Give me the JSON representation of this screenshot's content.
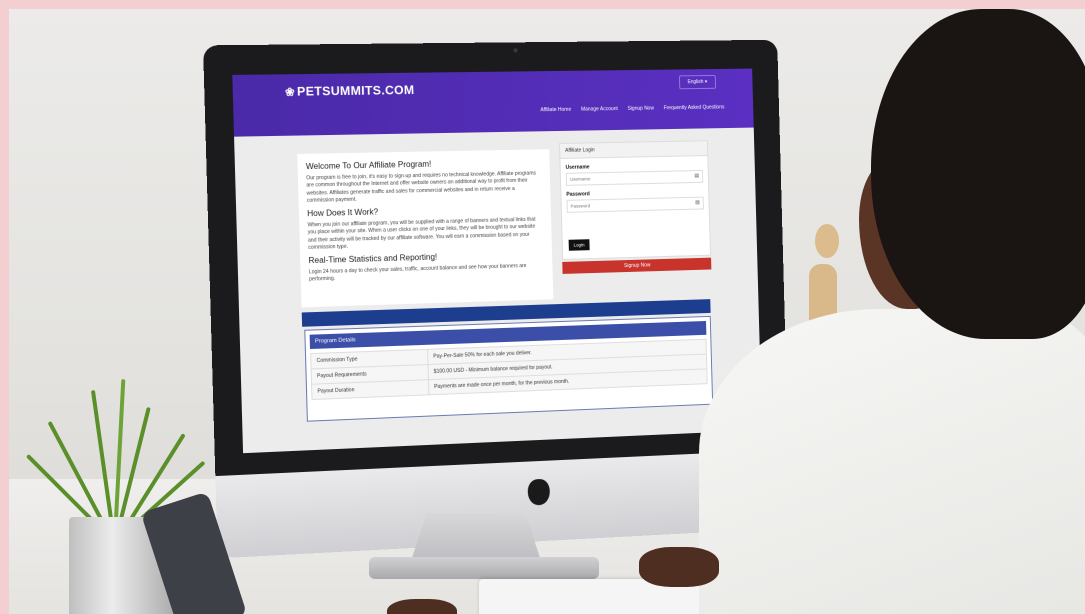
{
  "site": {
    "logo": "PETSUMMITS.COM",
    "language": "English",
    "nav": [
      "Affiliate Home",
      "Manage Account",
      "Signup Now",
      "Frequently Asked Questions"
    ]
  },
  "intro": {
    "h1": "Welcome To Our Affiliate Program!",
    "p1": "Our program is free to join, it's easy to sign-up and requires no technical knowledge. Affiliate programs are common throughout the Internet and offer website owners an additional way to profit from their websites. Affiliates generate traffic and sales for commercial websites and in return receive a commission payment.",
    "h2": "How Does It Work?",
    "p2": "When you join our affiliate program, you will be supplied with a range of banners and textual links that you place within your site. When a user clicks on one of your links, they will be brought to our website and their activity will be tracked by our affiliate software. You will earn a commission based on your commission type.",
    "h3": "Real-Time Statistics and Reporting!",
    "p3": "Login 24 hours a day to check your sales, traffic, account balance and see how your banners are performing."
  },
  "login": {
    "title": "Affiliate Login",
    "username_label": "Username",
    "username_placeholder": "Username",
    "password_label": "Password",
    "password_placeholder": "Password",
    "login_button": "Login",
    "signup_button": "Signup Now"
  },
  "program_details": {
    "title": "Program Details",
    "rows": [
      {
        "label": "Commission Type",
        "value": "Pay-Per-Sale 50% for each sale you deliver."
      },
      {
        "label": "Payout Requirements",
        "value": "$100.00 USD - Minimum balance required for payout."
      },
      {
        "label": "Payout Duration",
        "value": "Payments are made once per month, for the previous month."
      }
    ]
  },
  "colors": {
    "header": "#5a2fc2",
    "signup": "#c8342c",
    "band": "#1d3e8f"
  }
}
